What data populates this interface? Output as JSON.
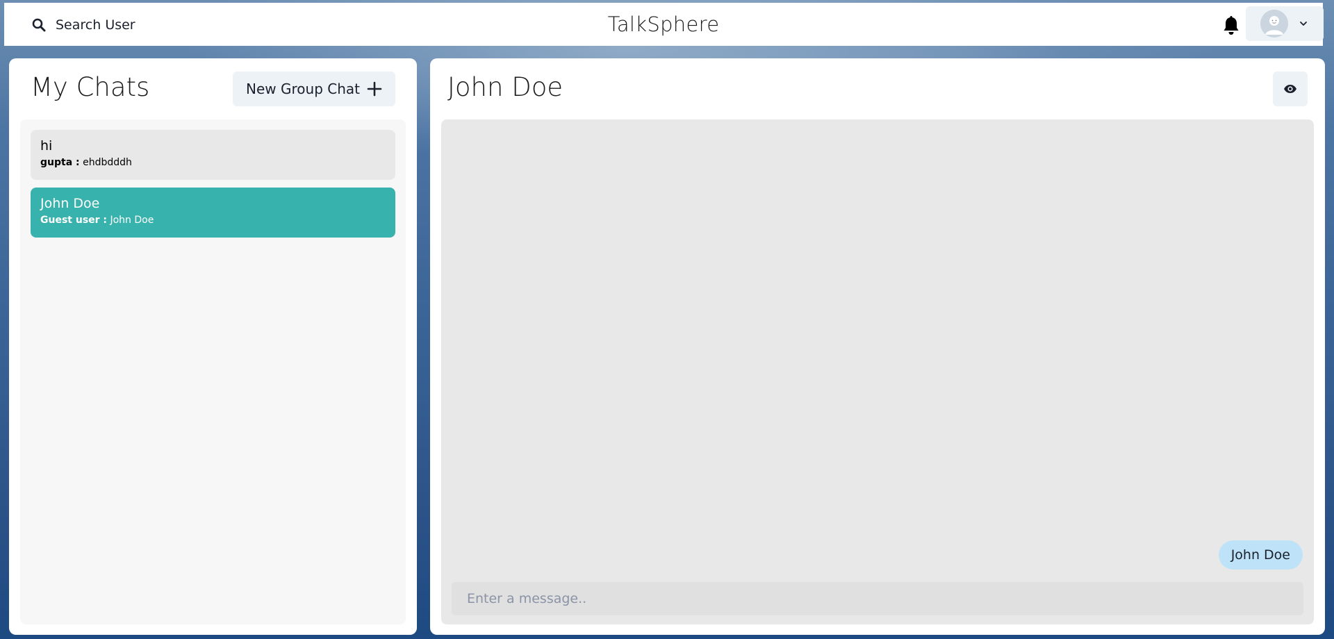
{
  "header": {
    "search_label": "Search User",
    "brand": "TalkSphere",
    "icons": {
      "search": "search-icon",
      "notifications": "bell-icon",
      "avatar": "avatar-icon",
      "dropdown": "chevron-down-icon"
    }
  },
  "sidebar": {
    "title": "My Chats",
    "new_group_label": "New Group Chat",
    "chats": [
      {
        "name": "hi",
        "sender": "gupta :",
        "message": "ehdbdddh",
        "active": false
      },
      {
        "name": "John Doe",
        "sender": "Guest user :",
        "message": "John Doe",
        "active": true
      }
    ]
  },
  "chat": {
    "title": "John Doe",
    "messages": [
      {
        "text": "John Doe",
        "own": true
      }
    ],
    "input_placeholder": "Enter a message..",
    "input_value": ""
  },
  "colors": {
    "active_chat": "#38b2ac",
    "own_bubble": "#bee3f8",
    "button_bg": "#edf2f7"
  }
}
